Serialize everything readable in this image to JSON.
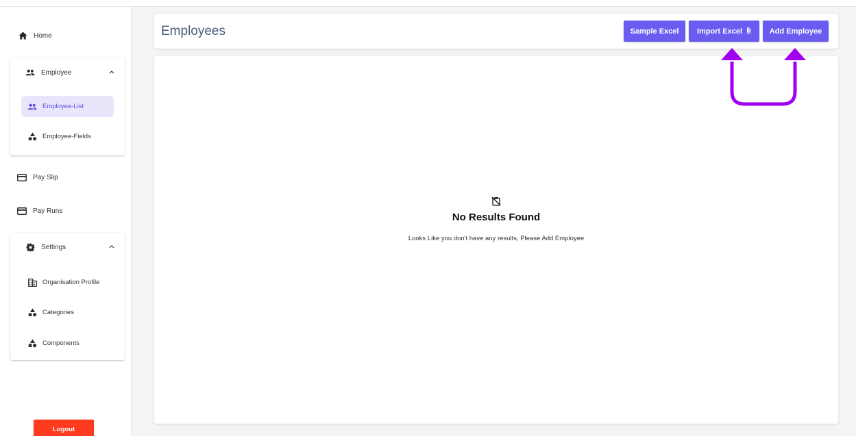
{
  "sidebar": {
    "home": "Home",
    "employee_group": {
      "label": "Employee",
      "items": [
        {
          "label": "Employee-List",
          "active": true,
          "icon": "people-icon"
        },
        {
          "label": "Employee-Fields",
          "active": false,
          "icon": "shapes-icon"
        }
      ]
    },
    "pay_slip": "Pay Slip",
    "pay_runs": "Pay Runs",
    "settings_group": {
      "label": "Settings",
      "items": [
        {
          "label": "Organisation Profile",
          "icon": "building-icon"
        },
        {
          "label": "Categories",
          "icon": "shapes-icon"
        },
        {
          "label": "Components",
          "icon": "shapes-icon"
        }
      ]
    },
    "logout": "Logout"
  },
  "header": {
    "title": "Employees",
    "buttons": {
      "sample_excel": "Sample Excel",
      "import_excel": "Import Excel",
      "add_employee": "Add Employee"
    }
  },
  "empty_state": {
    "title": "No Results Found",
    "description": "Looks Like you don't have any results, Please Add Employee"
  },
  "colors": {
    "accent": "#6a5cf0",
    "active_bg": "#e9e6fb",
    "logout": "#ff3b1f",
    "annotation": "#a000f0"
  }
}
